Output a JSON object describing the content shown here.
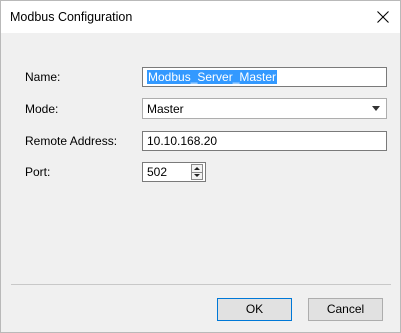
{
  "window": {
    "title": "Modbus Configuration",
    "close_icon": "close-icon"
  },
  "form": {
    "name": {
      "label": "Name:",
      "value": "Modbus_Server_Master"
    },
    "mode": {
      "label": "Mode:",
      "value": "Master"
    },
    "remote_address": {
      "label": "Remote Address:",
      "value": "10.10.168.20"
    },
    "port": {
      "label": "Port:",
      "value": "502"
    }
  },
  "buttons": {
    "ok": "OK",
    "cancel": "Cancel"
  },
  "colors": {
    "selection": "#3399ff",
    "default_button_border": "#0078d7"
  }
}
